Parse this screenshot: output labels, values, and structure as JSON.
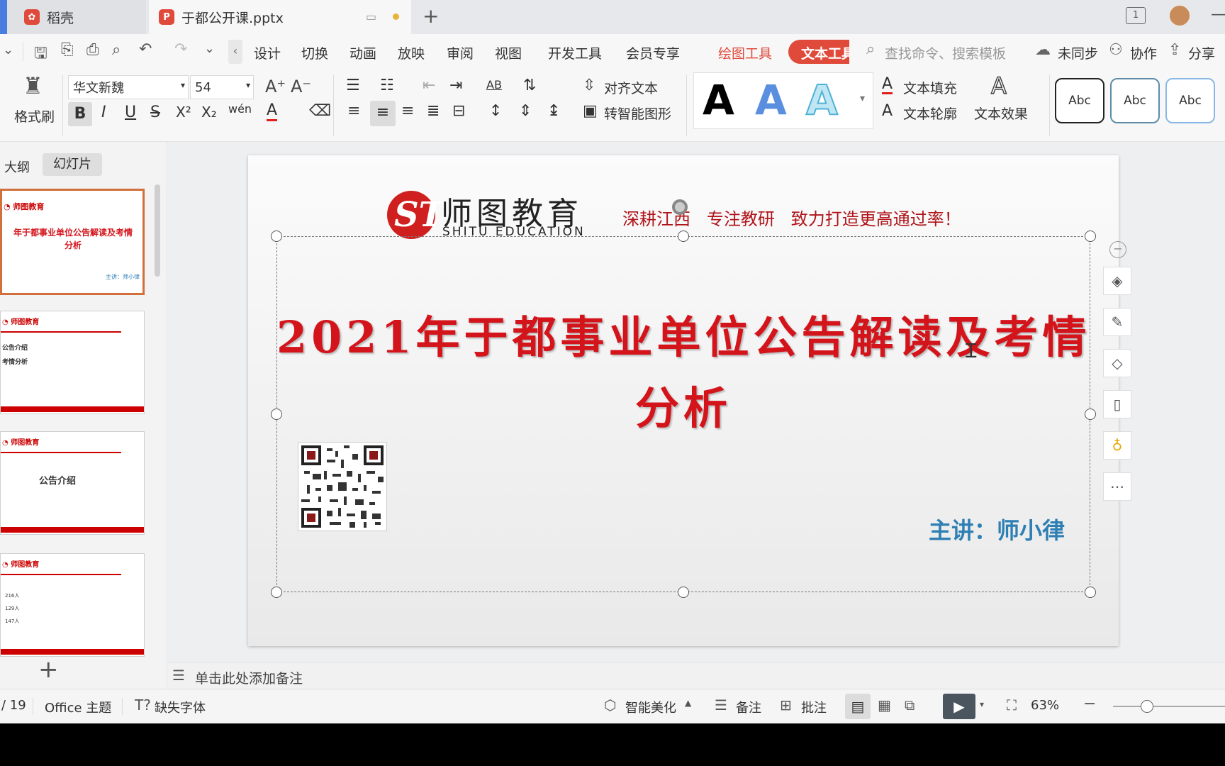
{
  "tabs": {
    "home": "稻壳",
    "doc": "于都公开课.pptx"
  },
  "menu": [
    "设计",
    "切换",
    "动画",
    "放映",
    "审阅",
    "视图",
    "开发工具",
    "会员专享"
  ],
  "context_tabs": {
    "drawing": "绘图工具",
    "text": "文本工具"
  },
  "search_placeholder": "查找命令、搜索模板",
  "actions": {
    "sync": "未同步",
    "collab": "协作",
    "share": "分享"
  },
  "ribbon": {
    "format_painter": "格式刷",
    "font_name": "华文新魏",
    "font_size": "54",
    "align_text": "对齐文本",
    "smart_shape": "转智能图形",
    "text_fill": "文本填充",
    "text_outline": "文本轮廓",
    "text_effect": "文本效果",
    "style_abc": "Abc",
    "big_a": "A"
  },
  "panel_tabs": {
    "outline": "大纲",
    "slides": "幻灯片"
  },
  "thumbs": {
    "t1_title": "年于都事业单位公告解读及考情",
    "t1_sub": "分析",
    "t1_speaker": "主讲：师小律",
    "t2_line1": "公告介绍",
    "t2_line2": "考情分析",
    "t3_text": "公告介绍",
    "t4_a": "216人",
    "t4_b": "129人",
    "t4_c": "147人"
  },
  "slide": {
    "logo_cn": "师图教育",
    "logo_en": "SHITU EDUCATION",
    "slogan": "深耕江西   专注教研   致力打造更高通过率！",
    "title_line1": "2021年于都事业单位公告解读及考情",
    "title_line2": "分析",
    "speaker": "主讲：师小律"
  },
  "notes_placeholder": "单击此处添加备注",
  "status": {
    "page": "/ 19",
    "theme": "Office 主题",
    "missing_font": "缺失字体",
    "beautify": "智能美化",
    "notes": "备注",
    "comment": "批注",
    "zoom": "63%"
  },
  "colors": {
    "accent": "#e04a3b",
    "title_red": "#d4141b",
    "speaker_blue": "#2e7fb3"
  }
}
